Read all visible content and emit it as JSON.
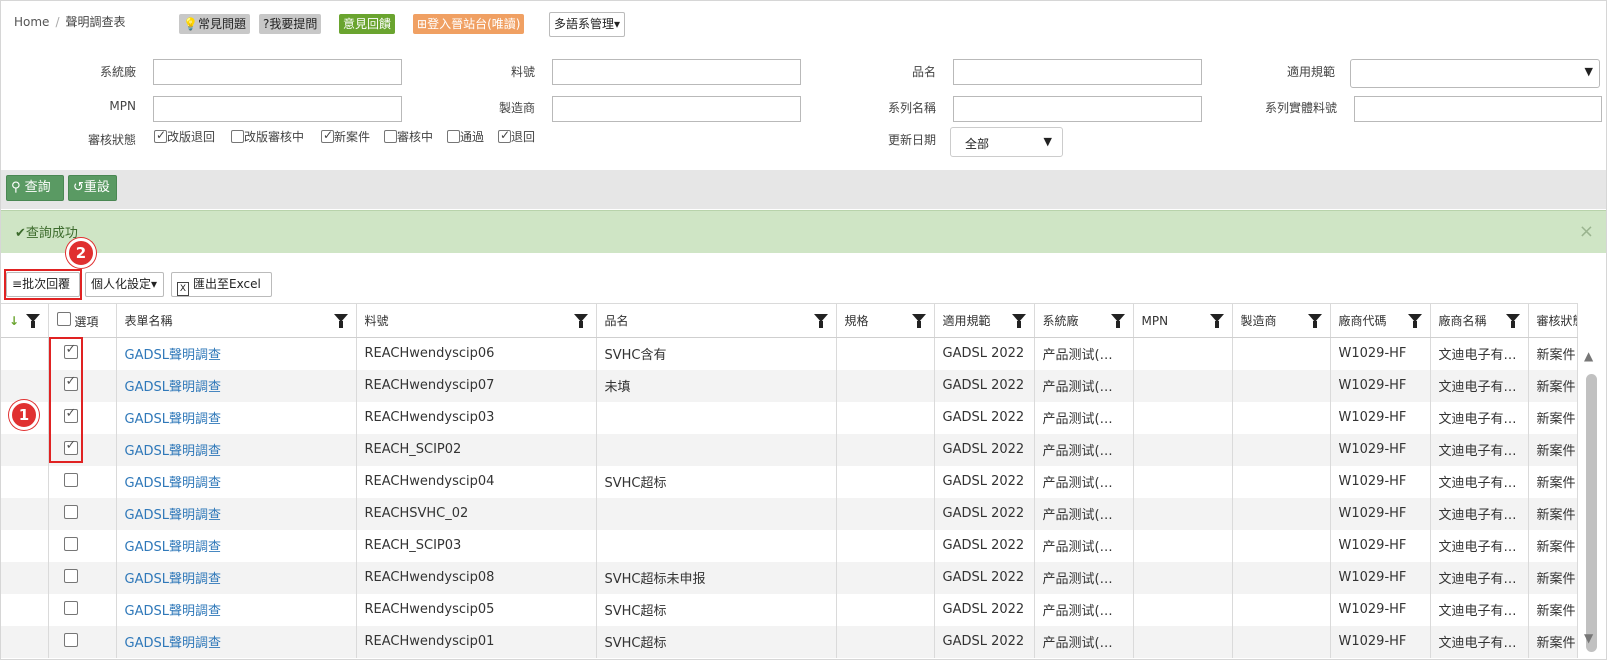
{
  "breadcrumb": {
    "home": "Home",
    "current": "聲明調查表"
  },
  "header_buttons": {
    "faq": "常見問題",
    "ask": "?我要提問",
    "feedback": "意見回饋",
    "login_site": "登入晉站台(唯讀)",
    "language": "多語系管理"
  },
  "filters": {
    "system_factory": "系統廠",
    "part_no": "料號",
    "product_name": "品名",
    "regulation": "適用規範",
    "mpn": "MPN",
    "manufacturer": "製造商",
    "series_name": "系列名稱",
    "series_entity_no": "系列實體料號",
    "review_status": "審核狀態",
    "update_date": "更新日期",
    "update_date_value": "全部",
    "status_options": [
      {
        "label": "改版退回",
        "checked": true
      },
      {
        "label": "改版審核中",
        "checked": false
      },
      {
        "label": "新案件",
        "checked": true
      },
      {
        "label": "審核中",
        "checked": false
      },
      {
        "label": "通過",
        "checked": false
      },
      {
        "label": "退回",
        "checked": true
      }
    ]
  },
  "actions": {
    "search": "查詢",
    "reset": "重設"
  },
  "alert": {
    "message": "查詢成功",
    "close": "×"
  },
  "toolbar": {
    "batch_reply": "批次回覆",
    "personalize": "個人化設定",
    "export": "匯出至Excel"
  },
  "table": {
    "headers": [
      "選項",
      "表單名稱",
      "料號",
      "品名",
      "規格",
      "適用規範",
      "系統廠",
      "MPN",
      "製造商",
      "廠商代碼",
      "廠商名稱",
      "審核狀態"
    ],
    "rows": [
      {
        "checked": true,
        "form": "GADSL聲明調查",
        "part": "REACHwendyscip06",
        "name": "SVHC含有",
        "spec": "",
        "reg": "GADSL 2022",
        "sys": "产品测试(…",
        "mpn": "",
        "mfr": "",
        "vcode": "W1029-HF",
        "vname": "文迪电子有…",
        "status": "新案件"
      },
      {
        "checked": true,
        "form": "GADSL聲明調查",
        "part": "REACHwendyscip07",
        "name": "未填",
        "spec": "",
        "reg": "GADSL 2022",
        "sys": "产品测试(…",
        "mpn": "",
        "mfr": "",
        "vcode": "W1029-HF",
        "vname": "文迪电子有…",
        "status": "新案件"
      },
      {
        "checked": true,
        "form": "GADSL聲明調查",
        "part": "REACHwendyscip03",
        "name": "",
        "spec": "",
        "reg": "GADSL 2022",
        "sys": "产品测试(…",
        "mpn": "",
        "mfr": "",
        "vcode": "W1029-HF",
        "vname": "文迪电子有…",
        "status": "新案件"
      },
      {
        "checked": true,
        "form": "GADSL聲明調查",
        "part": "REACH_SCIP02",
        "name": "",
        "spec": "",
        "reg": "GADSL 2022",
        "sys": "产品测试(…",
        "mpn": "",
        "mfr": "",
        "vcode": "W1029-HF",
        "vname": "文迪电子有…",
        "status": "新案件"
      },
      {
        "checked": false,
        "form": "GADSL聲明調查",
        "part": "REACHwendyscip04",
        "name": "SVHC超标",
        "spec": "",
        "reg": "GADSL 2022",
        "sys": "产品测试(…",
        "mpn": "",
        "mfr": "",
        "vcode": "W1029-HF",
        "vname": "文迪电子有…",
        "status": "新案件"
      },
      {
        "checked": false,
        "form": "GADSL聲明調查",
        "part": "REACHSVHC_02",
        "name": "",
        "spec": "",
        "reg": "GADSL 2022",
        "sys": "产品测试(…",
        "mpn": "",
        "mfr": "",
        "vcode": "W1029-HF",
        "vname": "文迪电子有…",
        "status": "新案件"
      },
      {
        "checked": false,
        "form": "GADSL聲明調查",
        "part": "REACH_SCIP03",
        "name": "",
        "spec": "",
        "reg": "GADSL 2022",
        "sys": "产品测试(…",
        "mpn": "",
        "mfr": "",
        "vcode": "W1029-HF",
        "vname": "文迪电子有…",
        "status": "新案件"
      },
      {
        "checked": false,
        "form": "GADSL聲明調查",
        "part": "REACHwendyscip08",
        "name": "SVHC超标未申报",
        "spec": "",
        "reg": "GADSL 2022",
        "sys": "产品测试(…",
        "mpn": "",
        "mfr": "",
        "vcode": "W1029-HF",
        "vname": "文迪电子有…",
        "status": "新案件"
      },
      {
        "checked": false,
        "form": "GADSL聲明調查",
        "part": "REACHwendyscip05",
        "name": "SVHC超标",
        "spec": "",
        "reg": "GADSL 2022",
        "sys": "产品测试(…",
        "mpn": "",
        "mfr": "",
        "vcode": "W1029-HF",
        "vname": "文迪电子有…",
        "status": "新案件"
      },
      {
        "checked": false,
        "form": "GADSL聲明調查",
        "part": "REACHwendyscip01",
        "name": "SVHC超标",
        "spec": "",
        "reg": "GADSL 2022",
        "sys": "产品测试(…",
        "mpn": "",
        "mfr": "",
        "vcode": "W1029-HF",
        "vname": "文迪电子有…",
        "status": "新案件"
      }
    ]
  },
  "annotations": {
    "badge1": "1",
    "badge2": "2"
  }
}
